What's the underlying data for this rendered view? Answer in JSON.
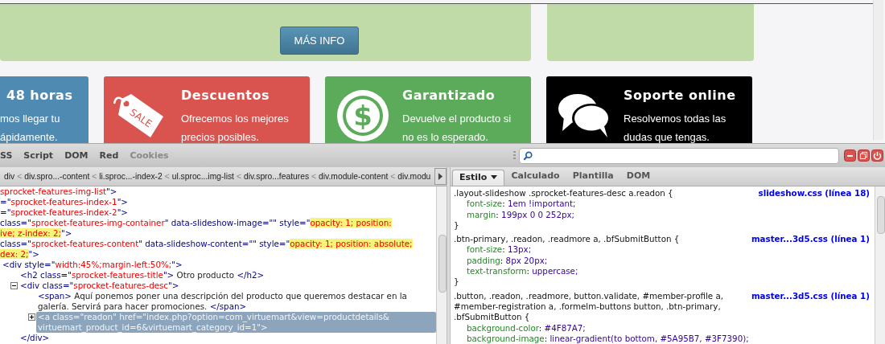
{
  "page": {
    "promo": {
      "button": "MÁS INFO"
    },
    "cards": [
      {
        "kind": "plain",
        "color": "#4f8ab3",
        "title": "48 horas",
        "lines": [
          "mos llegar tu",
          "ápidamente."
        ]
      },
      {
        "kind": "tag",
        "icon_text": "SALE",
        "color": "#d9534f",
        "title": "Descuentos",
        "lines": [
          "Ofrecemos los mejores",
          "precios posibles."
        ]
      },
      {
        "kind": "coin",
        "icon_text": "$",
        "color": "#5cab5a",
        "title": "Garantizado",
        "lines": [
          "Devuelve el producto si",
          "no es lo esperado."
        ]
      },
      {
        "kind": "bubbles",
        "color": "#000000",
        "title": "Soporte online",
        "lines": [
          "Resolvemos todas las",
          "dudas que tengas."
        ]
      }
    ]
  },
  "devtools": {
    "tabs": [
      {
        "label": "SS",
        "selected": false,
        "disabled": false
      },
      {
        "label": "Script",
        "selected": false,
        "disabled": false
      },
      {
        "label": "DOM",
        "selected": false,
        "disabled": false
      },
      {
        "label": "Red",
        "selected": false,
        "disabled": false
      },
      {
        "label": "Cookies",
        "selected": false,
        "disabled": true
      }
    ],
    "breadcrumb": [
      {
        "kind": "item",
        "label": "div"
      },
      {
        "kind": "separator",
        "label": "<"
      },
      {
        "kind": "item",
        "label": "div.spro...-content"
      },
      {
        "kind": "separator",
        "label": "<"
      },
      {
        "kind": "item",
        "label": "li.sproc...-index-2"
      },
      {
        "kind": "separator",
        "label": "<"
      },
      {
        "kind": "item",
        "label": "ul.sproc...img-list"
      },
      {
        "kind": "separator",
        "label": "<"
      },
      {
        "kind": "item",
        "label": "div.spro...features"
      },
      {
        "kind": "separator",
        "label": "<"
      },
      {
        "kind": "item",
        "label": "div.module-content"
      },
      {
        "kind": "separator",
        "label": "<"
      },
      {
        "kind": "item",
        "label": "div.modu"
      }
    ],
    "html_tree": [
      {
        "lines": [
          [
            {
              "kind": "value",
              "text": "sprocket-features-img-list"
            },
            {
              "kind": "tag",
              "text": "\">"
            }
          ]
        ]
      },
      {
        "lines": [
          [
            {
              "kind": "tag",
              "text": "=\""
            },
            {
              "kind": "value",
              "text": "sprocket-features-index-1"
            },
            {
              "kind": "tag",
              "text": "\">"
            }
          ]
        ]
      },
      {
        "lines": [
          [
            {
              "kind": "tag",
              "text": "=\""
            },
            {
              "kind": "value",
              "text": "sprocket-features-index-2"
            },
            {
              "kind": "tag",
              "text": "\">"
            }
          ]
        ]
      },
      {
        "lines": [
          [
            {
              "kind": "attr",
              "text": " class=\""
            },
            {
              "kind": "value",
              "text": "sprocket-features-img-container"
            },
            {
              "kind": "attr",
              "text": "\" data-slideshow-image=\"\" style=\""
            },
            {
              "kind": "hl",
              "text": "opacity: 1; position:"
            }
          ],
          [
            {
              "kind": "hl",
              "text": "ive; z-index: 2;"
            },
            {
              "kind": "tag",
              "text": "\">"
            }
          ]
        ]
      },
      {
        "lines": [
          [
            {
              "kind": "attr",
              "text": " class=\""
            },
            {
              "kind": "value",
              "text": "sprocket-features-content"
            },
            {
              "kind": "attr",
              "text": "\" data-slideshow-content=\"\" style=\""
            },
            {
              "kind": "hl",
              "text": "opacity: 1; position: absolute;"
            }
          ],
          [
            {
              "kind": "hl",
              "text": "dex: 2;"
            },
            {
              "kind": "tag",
              "text": "\">"
            }
          ]
        ]
      },
      {
        "lines": [
          [
            {
              "kind": "tag",
              "text": "<div"
            },
            {
              "kind": "attr",
              "text": " style=\""
            },
            {
              "kind": "value",
              "text": "width:45%;margin-left:50%;"
            },
            {
              "kind": "tag",
              "text": "\">"
            }
          ]
        ],
        "children": [
          {
            "lines": [
              [
                {
                  "kind": "tag",
                  "text": "<h2"
                },
                {
                  "kind": "attr",
                  "text": " class=\""
                },
                {
                  "kind": "value",
                  "text": "sprocket-features-title"
                },
                {
                  "kind": "tag",
                  "text": "\">"
                },
                {
                  "kind": "text",
                  "text": " Otro producto "
                },
                {
                  "kind": "tag",
                  "text": "</h2>"
                }
              ]
            ]
          },
          {
            "expanded": true,
            "lines": [
              [
                {
                  "kind": "tag",
                  "text": "<div"
                },
                {
                  "kind": "attr",
                  "text": " class=\""
                },
                {
                  "kind": "value",
                  "text": "sprocket-features-desc"
                },
                {
                  "kind": "tag",
                  "text": "\">"
                }
              ]
            ],
            "close": "</div>",
            "children": [
              {
                "lines": [
                  [
                    {
                      "kind": "tag",
                      "text": "<span>"
                    },
                    {
                      "kind": "text",
                      "text": " Aquí ponemos poner una descripción del producto que queremos destacar en la galería. Servirá para hacer promociones. "
                    },
                    {
                      "kind": "tag",
                      "text": "</span>"
                    }
                  ]
                ]
              },
              {
                "expanded": false,
                "selected": true,
                "lines": [
                  [
                    {
                      "kind": "tag",
                      "text": "<a class=\"readon\" href=\"index.php?option=com_virtuemart&view=productdetails&"
                    }
                  ],
                  [
                    {
                      "kind": "tag",
                      "text": "virtuemart_product_id=6&virtuemart_category_id=1\">"
                    }
                  ]
                ]
              }
            ]
          }
        ]
      }
    ],
    "style_tabs": [
      {
        "label": "Estilo",
        "selected": true,
        "dropdown": true
      },
      {
        "label": "Calculado",
        "selected": false,
        "dropdown": false
      },
      {
        "label": "Plantilla",
        "selected": false,
        "dropdown": false
      },
      {
        "label": "DOM",
        "selected": false,
        "dropdown": false
      }
    ],
    "rules": [
      {
        "selector": ".layout-slideshow .sprocket-features-desc a.readon {",
        "source": "slideshow.css (línea 18)",
        "declarations": [
          {
            "prop": "font-size",
            "colon": ":",
            "value": "1em !important;"
          },
          {
            "prop": "margin",
            "colon": ":",
            "value": "199px 0 0 252px;"
          }
        ],
        "close": "}"
      },
      {
        "selector": ".btn-primary, .readon, .readmore a, .bfSubmitButton {",
        "source": "master...3d5.css (línea 1)",
        "declarations": [
          {
            "prop": "font-size",
            "colon": ":",
            "value": "13px;"
          },
          {
            "prop": "padding",
            "colon": ":",
            "value": "8px 20px;"
          },
          {
            "prop": "text-transform",
            "colon": ":",
            "value": "uppercase;"
          }
        ],
        "close": "}"
      },
      {
        "selector": ".button, .readon, .readmore, button.validate, #member-profile a, #member-registration a, .formelm-buttons button, .btn-primary, .bfSubmitButton {",
        "source": "master...3d5.css (línea 1)",
        "declarations": [
          {
            "prop": "background-color",
            "colon": ":",
            "value": "#4F87A7;"
          },
          {
            "prop": "background-image",
            "colon": ":",
            "value": "linear-gradient(to bottom, #5A95B7, #3F7390);"
          }
        ]
      }
    ]
  }
}
